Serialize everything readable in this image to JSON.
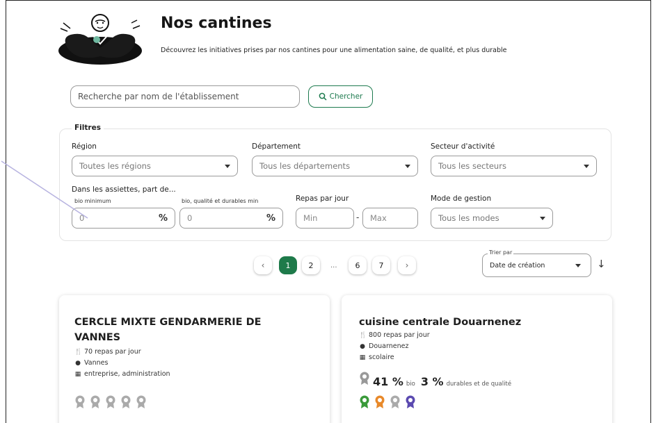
{
  "header": {
    "title": "Nos cantines",
    "subtitle": "Découvrez les initiatives prises par nos cantines pour une alimentation saine, de qualité, et plus durable"
  },
  "search": {
    "placeholder": "Recherche par nom de l'établissement",
    "button_label": "Chercher"
  },
  "filters": {
    "legend": "Filtres",
    "region": {
      "label": "Région",
      "value": "Toutes les régions"
    },
    "departement": {
      "label": "Département",
      "value": "Tous les départements"
    },
    "secteur": {
      "label": "Secteur d'activité",
      "value": "Tous les secteurs"
    },
    "assiettes": {
      "label": "Dans les assiettes, part de...",
      "bio_label": "bio minimum",
      "bio_placeholder": "0",
      "durable_label": "bio, qualité et durables min",
      "durable_placeholder": "0",
      "unit": "%"
    },
    "repas": {
      "label": "Repas par jour",
      "min_placeholder": "Min",
      "max_placeholder": "Max",
      "separator": "-"
    },
    "gestion": {
      "label": "Mode de gestion",
      "value": "Tous les modes"
    }
  },
  "pagination": {
    "prev": "‹",
    "pages": [
      "1",
      "2",
      "6",
      "7"
    ],
    "current": "1",
    "ellipsis": "...",
    "next": "›"
  },
  "sort": {
    "label": "Trier par",
    "value": "Date de création",
    "direction_icon": "arrow-down-icon"
  },
  "cards": [
    {
      "title": "CERCLE MIXTE GENDARMERIE DE VANNES",
      "meals": "70 repas par jour",
      "city": "Vannes",
      "sector": "entreprise, administration",
      "badges": [
        "#aaaaaa",
        "#aaaaaa",
        "#aaaaaa",
        "#aaaaaa",
        "#aaaaaa"
      ]
    },
    {
      "title": "cuisine centrale Douarnenez",
      "meals": "800 repas par jour",
      "city": "Douarnenez",
      "sector": "scolaire",
      "bio_value": "41 %",
      "bio_label": "bio",
      "durable_value": "3 %",
      "durable_label": "durables et de qualité",
      "badges": [
        "#3a9a3a",
        "#e8892a",
        "#aaaaaa",
        "#5b4ab0"
      ]
    }
  ],
  "colors": {
    "accent": "#1e7a4a"
  }
}
